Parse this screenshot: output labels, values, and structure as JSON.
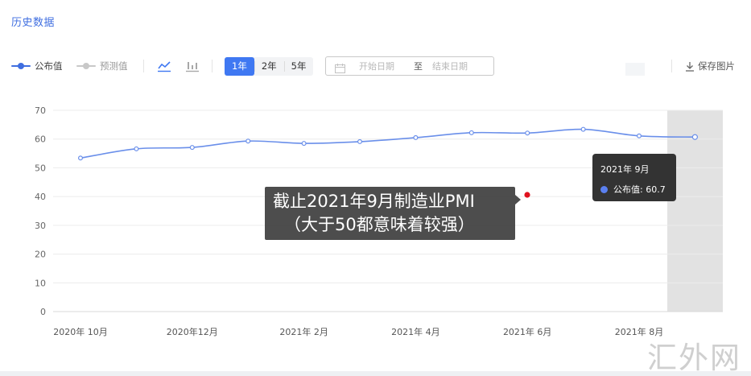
{
  "section": {
    "title": "历史数据"
  },
  "toolbar": {
    "legend_published": "公布值",
    "legend_predicted": "预测值",
    "line_chart_icon": "line-chart-icon",
    "bar_chart_icon": "bar-chart-icon",
    "ranges": [
      "1年",
      "2年",
      "5年"
    ],
    "active_range": "1年",
    "date_start_placeholder": "开始日期",
    "date_separator": "至",
    "date_end_placeholder": "结束日期",
    "calendar_icon": "calendar-icon",
    "save_label": "保存图片",
    "save_icon": "download-icon"
  },
  "overlay": {
    "line1": "截止2021年9月制造业PMI",
    "line2": "（大于50都意味着较强）",
    "marker_color": "#e0121e"
  },
  "tooltip": {
    "title": "2021年 9月",
    "label": "公布值: 60.7"
  },
  "watermark": {
    "text": "汇外网"
  },
  "colors": {
    "accent": "#3f78f2",
    "series_line": "#6a8fea",
    "hover_band": "#e2e2e2"
  },
  "chart_data": {
    "type": "line",
    "x": [
      "2020-10",
      "2020-11",
      "2020-12",
      "2021-01",
      "2021-02",
      "2021-03",
      "2021-04",
      "2021-05",
      "2021-06",
      "2021-07",
      "2021-08",
      "2021-09"
    ],
    "series": [
      {
        "name": "公布值",
        "values": [
          53.4,
          56.6,
          57.1,
          59.3,
          58.5,
          59.1,
          60.5,
          62.2,
          62.1,
          63.4,
          61.1,
          60.7
        ]
      }
    ],
    "xticks": [
      "2020年 10月",
      "2020年12月",
      "2021年 2月",
      "2021年 4月",
      "2021年 6月",
      "2021年 8月"
    ],
    "xtick_indices": [
      0,
      2,
      4,
      6,
      8,
      10
    ],
    "yticks": [
      0,
      10,
      20,
      30,
      40,
      50,
      60,
      70
    ],
    "ylim": [
      0,
      70
    ],
    "grid": true,
    "highlight_index": 11
  }
}
